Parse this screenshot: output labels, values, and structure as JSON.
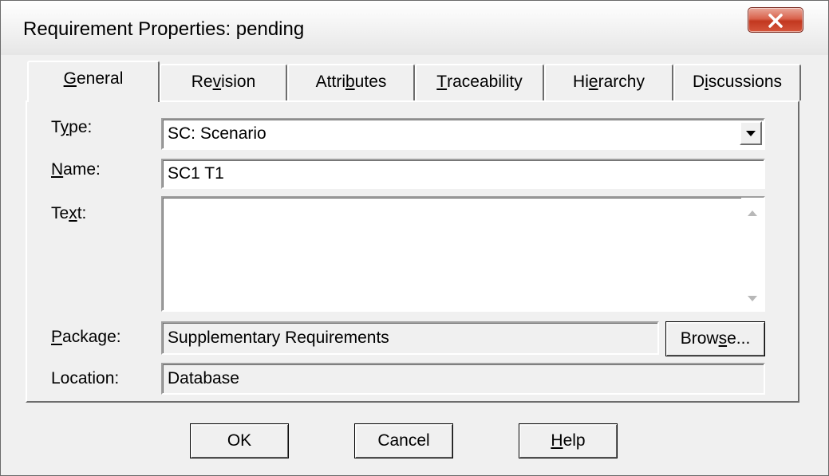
{
  "window": {
    "title": "Requirement Properties: pending"
  },
  "tabs": [
    {
      "label": "General",
      "mnemonic_index": 0,
      "active": true
    },
    {
      "label": "Revision",
      "mnemonic_index": 2,
      "active": false
    },
    {
      "label": "Attributes",
      "mnemonic_index": 5,
      "active": false
    },
    {
      "label": "Traceability",
      "mnemonic_index": 0,
      "active": false
    },
    {
      "label": "Hierarchy",
      "mnemonic_index": 2,
      "active": false
    },
    {
      "label": "Discussions",
      "mnemonic_index": 1,
      "active": false
    }
  ],
  "form": {
    "type_label": "Type:",
    "type_value": "SC: Scenario",
    "name_label": "Name:",
    "name_value": "SC1 T1",
    "text_label": "Text:",
    "text_value": "",
    "package_label": "Package:",
    "package_value": "Supplementary Requirements",
    "browse_label": "Browse...",
    "location_label": "Location:",
    "location_value": "Database"
  },
  "buttons": {
    "ok": "OK",
    "cancel": "Cancel",
    "help": "Help"
  },
  "icons": {
    "close": "close-icon",
    "dropdown": "dropdown-arrow-icon"
  },
  "colors": {
    "close_button": "#c2381f",
    "dialog_bg": "#f0f0f0"
  }
}
